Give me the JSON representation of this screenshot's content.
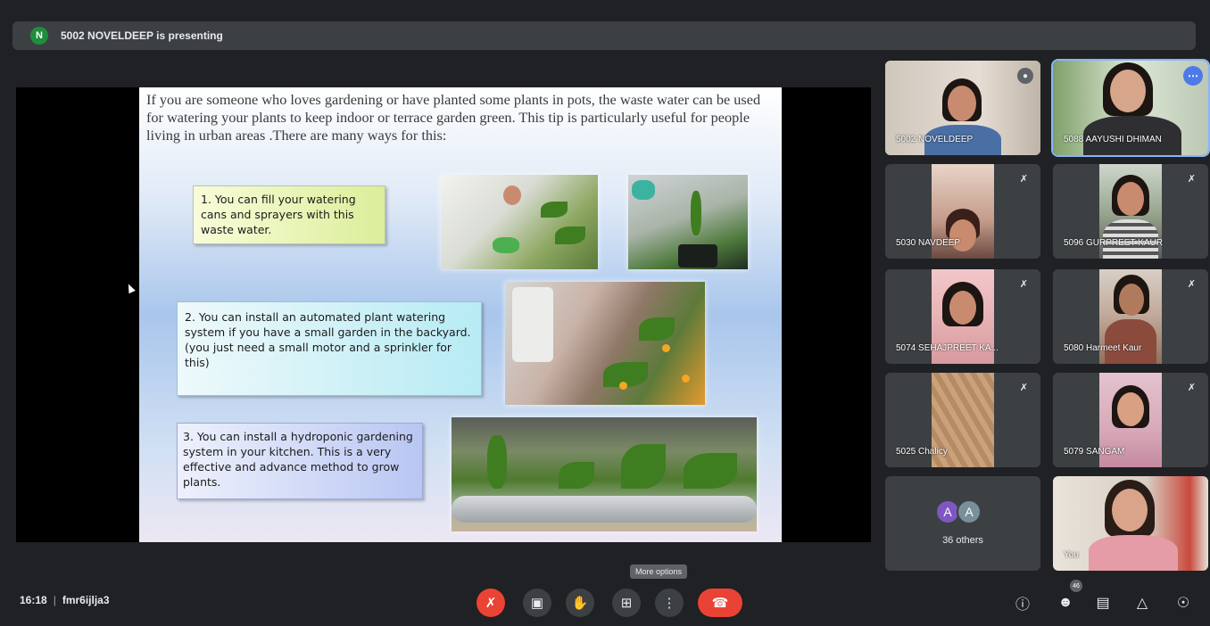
{
  "presenting_bar": {
    "avatar_letter": "N",
    "text": "5002 NOVELDEEP is presenting"
  },
  "slide": {
    "paragraph": "If you are someone who loves gardening or have planted some plants in pots, the waste water can be used for watering your plants to keep indoor or terrace garden green. This tip is particularly useful for people living in urban areas .There are many ways for this:",
    "tip1": "1. You can fill your watering cans and sprayers with this waste water.",
    "tip2": "2. You can install an automated plant watering system if you have a small garden in the backyard.(you just need a small motor and a sprinkler for this)",
    "tip3": "3. You can install a hydroponic gardening system in your kitchen. This is a very effective and advance method to grow plants."
  },
  "participants": [
    {
      "name": "5002 NOVELDEEP",
      "icon": "pin-icon"
    },
    {
      "name": "5088 AAYUSHI DHIMAN",
      "icon": "more-options-icon"
    },
    {
      "name": "5030 NAVDEEP",
      "icon": "mic-off-icon"
    },
    {
      "name": "5096 GURPREET KAUR",
      "icon": "mic-off-icon"
    },
    {
      "name": "5074 SEHAJPREET KA...",
      "icon": "mic-off-icon"
    },
    {
      "name": "5080 Harmeet Kaur",
      "icon": "mic-off-icon"
    },
    {
      "name": "5025 Chalicy",
      "icon": "mic-off-icon"
    },
    {
      "name": "5079 SANGAM",
      "icon": "mic-off-icon"
    },
    {
      "name": "You",
      "icon": ""
    }
  ],
  "others": {
    "avatars": [
      "A",
      "A"
    ],
    "label": "36 others"
  },
  "bottom": {
    "time": "16:18",
    "meeting_code": "fmr6ijlja3",
    "tooltip": "More options",
    "participant_count": "46"
  },
  "colors": {
    "end_call": "#ea4335",
    "background": "#202124",
    "tile": "#3c4043",
    "active_speaker": "#8ab4f8"
  }
}
